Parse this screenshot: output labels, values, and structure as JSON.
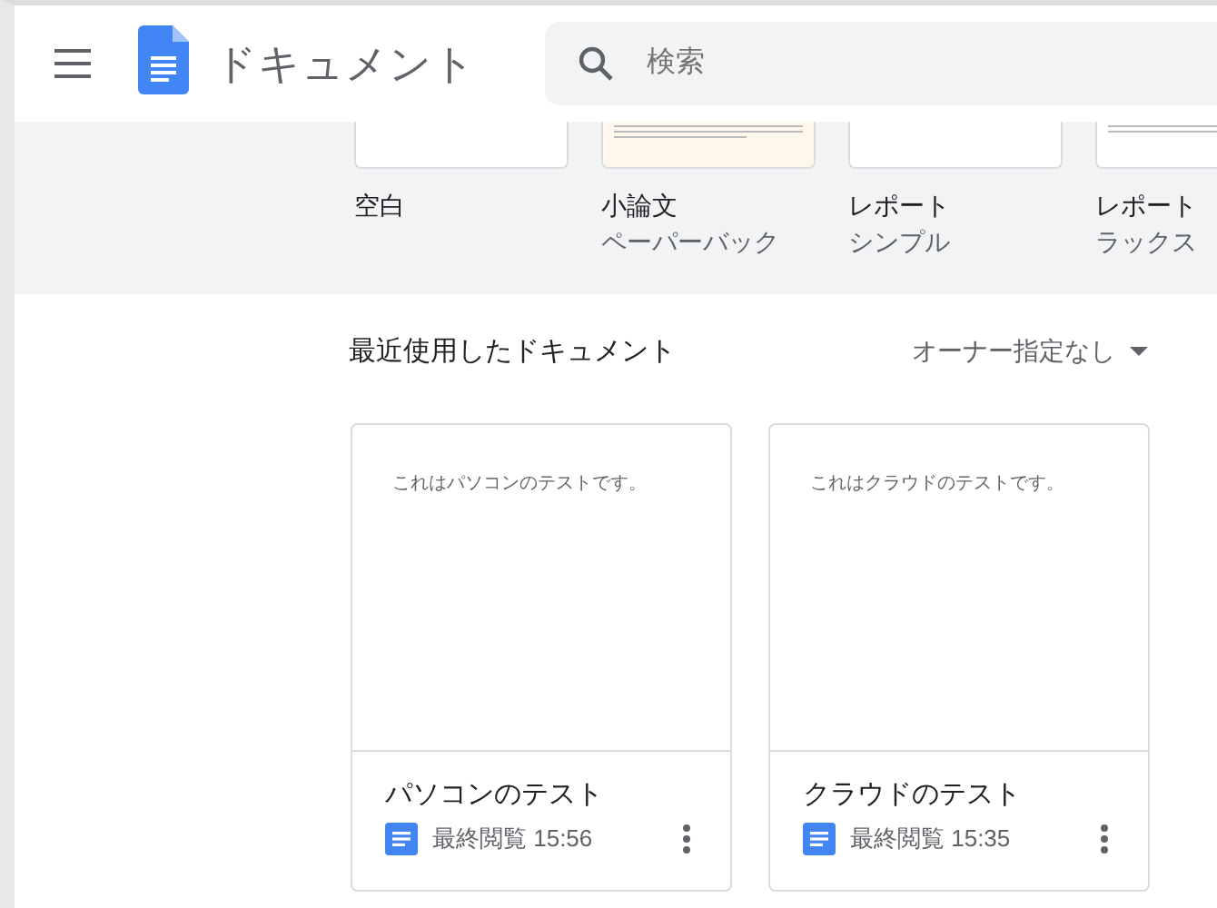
{
  "header": {
    "title": "ドキュメント",
    "search": {
      "placeholder": "検索"
    }
  },
  "templates": [
    {
      "kind": "blank",
      "name": "空白"
    },
    {
      "kind": "essay",
      "name": "小論文",
      "subtitle": "ペーパーバック"
    },
    {
      "kind": "plain",
      "name": "レポート",
      "subtitle": "シンプル"
    },
    {
      "kind": "report",
      "name": "レポート",
      "subtitle": "ラックス"
    }
  ],
  "recent": {
    "title": "最近使用したドキュメント",
    "owner_filter": "オーナー指定なし",
    "documents": [
      {
        "preview": "これはパソコンのテストです。",
        "name": "パソコンのテスト",
        "opened": "最終閲覧 15:56"
      },
      {
        "preview": "これはクラウドのテストです。",
        "name": "クラウドのテスト",
        "opened": "最終閲覧 15:35"
      }
    ]
  }
}
